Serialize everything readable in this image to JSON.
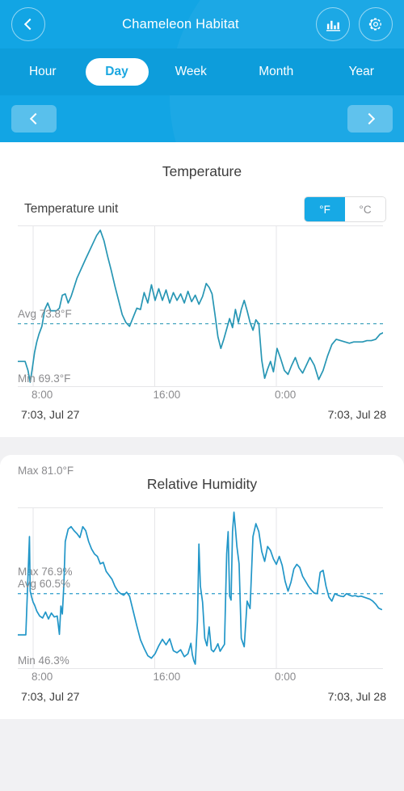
{
  "header": {
    "title": "Chameleon Habitat",
    "back_icon": "chevron-left-icon",
    "chart_icon": "bar-chart-icon",
    "settings_icon": "gear-icon",
    "accent": "#12a5e4",
    "tabbar_color": "#0d9ddb",
    "tabs": [
      {
        "label": "Hour",
        "active": false
      },
      {
        "label": "Day",
        "active": true
      },
      {
        "label": "Week",
        "active": false
      },
      {
        "label": "Month",
        "active": false
      },
      {
        "label": "Year",
        "active": false
      }
    ],
    "pager": {
      "prev_icon": "chevron-left-icon",
      "next_icon": "chevron-right-icon"
    }
  },
  "temperature_card": {
    "title": "Temperature",
    "unit_label": "Temperature unit",
    "unit_options": [
      {
        "label": "°F",
        "selected": true
      },
      {
        "label": "°C",
        "selected": false
      }
    ],
    "max_label": "Max 81.0°F",
    "avg_label": "Avg 73.8°F",
    "min_label": "Min 69.3°F",
    "x_ticks": [
      "8:00",
      "16:00",
      "0:00"
    ],
    "range_start": "7:03,  Jul 27",
    "range_end": "7:03,  Jul 28",
    "line_color": "#2796b4"
  },
  "humidity_card": {
    "title": "Relative Humidity",
    "max_label": "Max 76.9%",
    "avg_label": "Avg 60.5%",
    "min_label": "Min 46.3%",
    "x_ticks": [
      "8:00",
      "16:00",
      "0:00"
    ],
    "range_start": "7:03,  Jul 27",
    "range_end": "7:03,  Jul 28",
    "line_color": "#2196c8"
  },
  "chart_data": [
    {
      "type": "line",
      "title": "Temperature",
      "xlabel": "",
      "ylabel": "°F",
      "ylim": [
        69.3,
        81.0
      ],
      "xlim": [
        "7:03 Jul 27",
        "7:03 Jul 28"
      ],
      "x_tick_labels": [
        "8:00",
        "16:00",
        "0:00"
      ],
      "x_tick_fracs": [
        0.042,
        0.375,
        0.708
      ],
      "grid": true,
      "legend": "none",
      "annotations": {
        "max": 81.0,
        "avg": 73.8,
        "min": 69.3,
        "avg_line": "dashed"
      },
      "series": [
        {
          "name": "Temperature (°F)",
          "unit": "°F",
          "x_frac": [
            0.0,
            0.01,
            0.02,
            0.028,
            0.034,
            0.04,
            0.046,
            0.052,
            0.058,
            0.066,
            0.074,
            0.082,
            0.09,
            0.098,
            0.106,
            0.114,
            0.122,
            0.13,
            0.138,
            0.146,
            0.154,
            0.162,
            0.17,
            0.178,
            0.186,
            0.196,
            0.206,
            0.216,
            0.226,
            0.236,
            0.246,
            0.256,
            0.266,
            0.276,
            0.286,
            0.296,
            0.306,
            0.316,
            0.326,
            0.336,
            0.346,
            0.356,
            0.366,
            0.376,
            0.386,
            0.396,
            0.406,
            0.416,
            0.426,
            0.436,
            0.446,
            0.456,
            0.466,
            0.476,
            0.486,
            0.496,
            0.506,
            0.516,
            0.524,
            0.532,
            0.54,
            0.548,
            0.556,
            0.564,
            0.572,
            0.58,
            0.588,
            0.596,
            0.604,
            0.612,
            0.62,
            0.628,
            0.636,
            0.644,
            0.652,
            0.66,
            0.668,
            0.676,
            0.684,
            0.692,
            0.7,
            0.71,
            0.72,
            0.73,
            0.74,
            0.75,
            0.76,
            0.77,
            0.78,
            0.79,
            0.8,
            0.812,
            0.824,
            0.836,
            0.848,
            0.86,
            0.872,
            0.884,
            0.896,
            0.908,
            0.92,
            0.932,
            0.944,
            0.956,
            0.968,
            0.98,
            0.992,
            1.0
          ],
          "values": [
            70.9,
            70.9,
            70.9,
            70.2,
            69.3,
            70.4,
            71.6,
            72.4,
            73.0,
            73.6,
            74.9,
            75.4,
            74.8,
            74.8,
            74.8,
            75.0,
            76.0,
            76.1,
            75.4,
            75.9,
            76.6,
            77.3,
            77.8,
            78.3,
            78.8,
            79.4,
            80.0,
            80.6,
            81.0,
            80.2,
            79.0,
            77.9,
            76.7,
            75.6,
            74.5,
            73.9,
            73.6,
            74.3,
            75.0,
            74.9,
            76.2,
            75.4,
            76.8,
            75.6,
            76.5,
            75.6,
            76.4,
            75.4,
            76.2,
            75.6,
            76.1,
            75.4,
            76.3,
            75.5,
            76.0,
            75.3,
            75.9,
            76.9,
            76.6,
            76.1,
            74.5,
            72.8,
            71.9,
            72.6,
            73.4,
            74.2,
            73.5,
            74.9,
            73.9,
            74.9,
            75.6,
            74.8,
            73.9,
            73.3,
            74.1,
            73.8,
            71.0,
            69.6,
            70.3,
            70.9,
            70.1,
            71.9,
            71.1,
            70.2,
            69.9,
            70.6,
            71.2,
            70.4,
            70.0,
            70.6,
            71.2,
            70.6,
            69.5,
            70.2,
            71.3,
            72.2,
            72.6,
            72.5,
            72.4,
            72.3,
            72.4,
            72.4,
            72.4,
            72.5,
            72.5,
            72.6,
            73.0,
            73.1
          ]
        }
      ]
    },
    {
      "type": "line",
      "title": "Relative Humidity",
      "xlabel": "",
      "ylabel": "%",
      "ylim": [
        46.3,
        76.9
      ],
      "xlim": [
        "7:03 Jul 27",
        "7:03 Jul 28"
      ],
      "x_tick_labels": [
        "8:00",
        "16:00",
        "0:00"
      ],
      "x_tick_fracs": [
        0.042,
        0.375,
        0.708
      ],
      "grid": true,
      "legend": "none",
      "annotations": {
        "max": 76.9,
        "avg": 60.5,
        "min": 46.3,
        "avg_line": "dashed"
      },
      "series": [
        {
          "name": "Relative Humidity (%)",
          "unit": "%",
          "x_frac": [
            0.0,
            0.012,
            0.022,
            0.03,
            0.032,
            0.034,
            0.038,
            0.042,
            0.046,
            0.052,
            0.06,
            0.068,
            0.076,
            0.084,
            0.092,
            0.1,
            0.108,
            0.114,
            0.118,
            0.122,
            0.126,
            0.13,
            0.138,
            0.146,
            0.154,
            0.162,
            0.17,
            0.178,
            0.186,
            0.194,
            0.202,
            0.21,
            0.218,
            0.226,
            0.234,
            0.242,
            0.25,
            0.258,
            0.266,
            0.274,
            0.282,
            0.29,
            0.298,
            0.306,
            0.316,
            0.326,
            0.336,
            0.346,
            0.356,
            0.366,
            0.376,
            0.386,
            0.396,
            0.406,
            0.416,
            0.426,
            0.436,
            0.446,
            0.456,
            0.466,
            0.474,
            0.478,
            0.482,
            0.486,
            0.492,
            0.496,
            0.5,
            0.506,
            0.512,
            0.518,
            0.524,
            0.53,
            0.536,
            0.542,
            0.548,
            0.554,
            0.56,
            0.566,
            0.572,
            0.576,
            0.58,
            0.584,
            0.588,
            0.592,
            0.596,
            0.6,
            0.606,
            0.612,
            0.62,
            0.628,
            0.636,
            0.644,
            0.652,
            0.66,
            0.668,
            0.676,
            0.684,
            0.692,
            0.7,
            0.708,
            0.716,
            0.724,
            0.732,
            0.74,
            0.748,
            0.756,
            0.764,
            0.772,
            0.78,
            0.788,
            0.796,
            0.804,
            0.812,
            0.82,
            0.828,
            0.836,
            0.844,
            0.852,
            0.86,
            0.868,
            0.876,
            0.884,
            0.892,
            0.9,
            0.908,
            0.916,
            0.924,
            0.932,
            0.94,
            0.948,
            0.956,
            0.964,
            0.972,
            0.98,
            0.988,
            0.996,
            1.0
          ],
          "values": [
            52.2,
            52.2,
            52.2,
            68.0,
            72.0,
            61.0,
            59.8,
            58.8,
            58.2,
            57.0,
            56.0,
            55.6,
            56.8,
            55.4,
            56.6,
            55.8,
            56.0,
            52.3,
            58.0,
            56.4,
            62.0,
            71.0,
            73.5,
            74.0,
            73.2,
            72.6,
            71.8,
            74.0,
            73.2,
            71.0,
            69.5,
            68.5,
            68.0,
            66.5,
            66.8,
            65.0,
            64.2,
            63.4,
            62.0,
            61.0,
            60.5,
            60.2,
            60.8,
            60.0,
            57.0,
            54.0,
            51.2,
            49.5,
            48.0,
            47.5,
            48.4,
            50.0,
            51.3,
            50.2,
            51.4,
            49.0,
            48.6,
            49.2,
            47.8,
            48.4,
            50.5,
            48.2,
            47.0,
            46.3,
            55.0,
            70.5,
            62.0,
            58.8,
            51.5,
            50.0,
            53.8,
            49.2,
            48.8,
            49.5,
            50.4,
            48.9,
            49.6,
            50.3,
            68.5,
            73.0,
            60.0,
            59.2,
            73.0,
            76.9,
            73.6,
            70.0,
            66.5,
            51.5,
            49.8,
            59.0,
            57.5,
            72.0,
            74.6,
            73.0,
            69.0,
            67.0,
            70.0,
            69.2,
            67.5,
            66.4,
            68.0,
            66.2,
            63.0,
            61.0,
            62.8,
            65.5,
            66.4,
            65.8,
            64.0,
            63.0,
            62.0,
            61.2,
            60.6,
            60.5,
            64.8,
            65.2,
            62.0,
            59.8,
            59.0,
            60.5,
            60.2,
            60.0,
            59.9,
            60.5,
            60.2,
            60.0,
            60.1,
            59.9,
            60.0,
            59.8,
            59.6,
            59.4,
            59.0,
            58.4,
            57.6,
            57.3
          ]
        }
      ]
    }
  ]
}
